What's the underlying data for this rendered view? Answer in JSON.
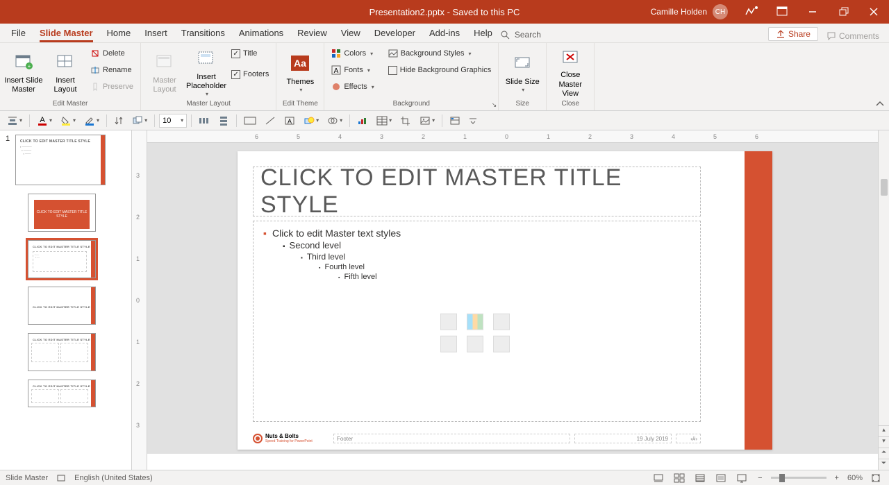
{
  "title_bar": {
    "filename": "Presentation2.pptx",
    "saved_state": " - Saved to this PC",
    "user": "Camille Holden",
    "initials": "CH"
  },
  "tabs": {
    "file": "File",
    "slide_master": "Slide Master",
    "home": "Home",
    "insert": "Insert",
    "transitions": "Transitions",
    "animations": "Animations",
    "review": "Review",
    "view": "View",
    "developer": "Developer",
    "addins": "Add-ins",
    "help": "Help",
    "search_placeholder": "Search",
    "share": "Share",
    "comments": "Comments"
  },
  "ribbon": {
    "edit_master": {
      "label": "Edit Master",
      "insert_slide_master": "Insert Slide Master",
      "insert_layout": "Insert Layout",
      "delete": "Delete",
      "rename": "Rename",
      "preserve": "Preserve"
    },
    "master_layout": {
      "label": "Master Layout",
      "master_layout_btn": "Master Layout",
      "insert_placeholder": "Insert Placeholder",
      "title": "Title",
      "footers": "Footers"
    },
    "edit_theme": {
      "label": "Edit Theme",
      "themes": "Themes"
    },
    "background": {
      "label": "Background",
      "colors": "Colors",
      "fonts": "Fonts",
      "effects": "Effects",
      "bg_styles": "Background Styles",
      "hide_bg": "Hide Background Graphics"
    },
    "size": {
      "label": "Size",
      "slide_size": "Slide Size"
    },
    "close": {
      "label": "Close",
      "close_master": "Close Master View"
    }
  },
  "quick_bar": {
    "font_size": "10"
  },
  "slide": {
    "title": "Click to edit Master title style",
    "l1": "Click to edit Master text styles",
    "l2": "Second level",
    "l3": "Third level",
    "l4": "Fourth level",
    "l5": "Fifth level",
    "footer": "Footer",
    "date": "19 July 2019",
    "num": "‹#›",
    "logo": "Nuts & Bolts",
    "logo_sub": "Speed Training for PowerPoint"
  },
  "thumbs": {
    "master_label": "CLICK TO EDIT MASTER TITLE STYLE",
    "orange_label": "CLICK TO EDIT MASTER TITLE STYLE",
    "layout_label": "CLICK TO EDIT MASTER TITLE STYLE"
  },
  "status": {
    "mode": "Slide Master",
    "lang": "English (United States)",
    "zoom": "60%"
  },
  "ruler_ticks": [
    "6",
    "5",
    "4",
    "3",
    "2",
    "1",
    "0",
    "1",
    "2",
    "3",
    "4",
    "5",
    "6"
  ]
}
